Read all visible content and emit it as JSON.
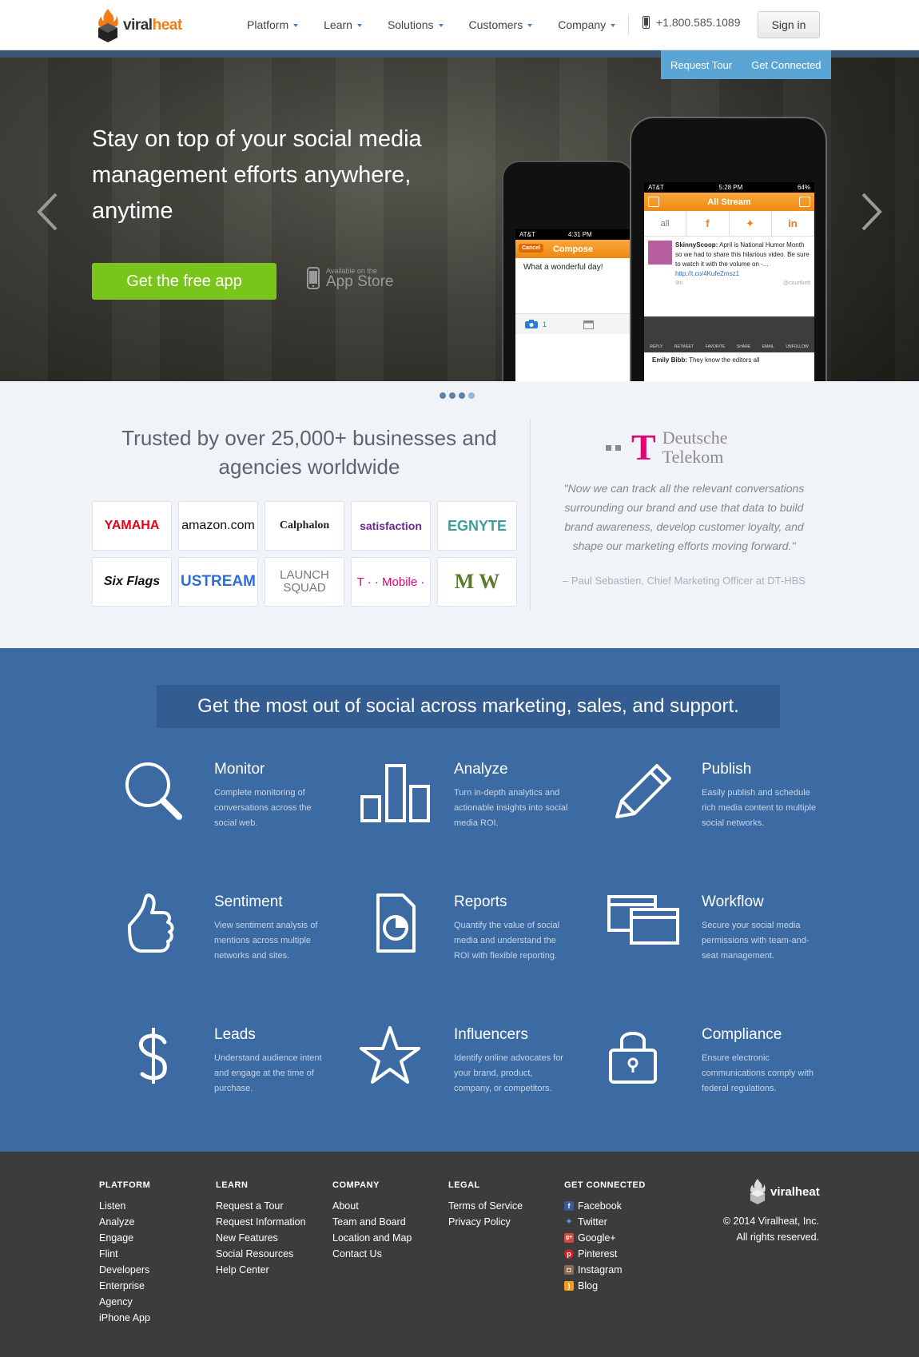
{
  "header": {
    "logo_viral": "viral",
    "logo_heat": "heat",
    "nav": [
      "Platform",
      "Learn",
      "Solutions",
      "Customers",
      "Company"
    ],
    "phone": "+1.800.585.1089",
    "signin": "Sign in"
  },
  "cta_tabs": [
    "Request Tour",
    "Get Connected"
  ],
  "hero": {
    "title": "Stay on top of your social media management efforts anywhere, anytime",
    "button": "Get the free app",
    "appstore_small": "Available on the",
    "appstore_big": "App Store",
    "slide_dots": 4,
    "active_dot": 4
  },
  "phone_back": {
    "carrier": "AT&T",
    "time": "4:31 PM",
    "cancel": "Cancel",
    "title": "Compose",
    "text": "What a wonderful day!",
    "photo_count": "1"
  },
  "phone_front": {
    "carrier": "AT&T",
    "time": "5:28 PM",
    "battery": "64%",
    "title": "All Stream",
    "tab_all": "all",
    "tweet_user": "SkinnyScoop:",
    "tweet_text": "April is National Humor Month so we had to share this hilarious video. Be sure to watch it with the volume on -...",
    "tweet_link": "http://t.co/4KufeZmsz1",
    "tweet_time": "9m",
    "tweet_handle": "@courtkett",
    "actions": [
      "REPLY",
      "RETWEET",
      "FAVORITE",
      "SHARE",
      "EMAIL",
      "UNFOLLOW"
    ],
    "next_user": "Emily Bibb:",
    "next_text": "They know the editors all"
  },
  "trusted": {
    "title": "Trusted by over 25,000+ businesses and agencies worldwide",
    "logos": [
      "YAMAHA",
      "amazon.com",
      "Calphalon",
      "satisfaction",
      "EGNYTE",
      "Six Flags",
      "USTREAM",
      "LAUNCH SQUAD",
      "T · · Mobile ·",
      "M W"
    ],
    "dt_name_1": "Deutsche",
    "dt_name_2": "Telekom",
    "quote": "\"Now we can track all the relevant conversations surrounding our brand and use that data to build brand awareness, develop customer loyalty, and shape our marketing efforts moving forward.\"",
    "quote_by": "– Paul Sebastien, Chief Marketing Officer at DT-HBS"
  },
  "features": {
    "banner": "Get the most out of social across marketing, sales, and support.",
    "items": [
      {
        "title": "Monitor",
        "desc": "Complete monitoring of conversations across the social web.",
        "icon": "magnifier-icon"
      },
      {
        "title": "Analyze",
        "desc": "Turn in-depth analytics and actionable insights into social media ROI.",
        "icon": "bar-chart-icon"
      },
      {
        "title": "Publish",
        "desc": "Easily publish and schedule rich media content to multiple social networks.",
        "icon": "pencil-icon"
      },
      {
        "title": "Sentiment",
        "desc": "View sentiment analysis of mentions across multiple networks and sites.",
        "icon": "thumbs-up-icon"
      },
      {
        "title": "Reports",
        "desc": "Quantify the value of social media and understand the ROI with flexible reporting.",
        "icon": "report-icon"
      },
      {
        "title": "Workflow",
        "desc": "Secure your social media permissions with team-and-seat management.",
        "icon": "windows-icon"
      },
      {
        "title": "Leads",
        "desc": "Understand audience intent and engage at the time of purchase.",
        "icon": "dollar-icon"
      },
      {
        "title": "Influencers",
        "desc": "Identify online advocates for your brand, product, company, or competitors.",
        "icon": "star-icon"
      },
      {
        "title": "Compliance",
        "desc": "Ensure electronic communications comply with federal regulations.",
        "icon": "lock-icon"
      }
    ]
  },
  "footer": {
    "platform": {
      "head": "PLATFORM",
      "links": [
        "Listen",
        "Analyze",
        "Engage",
        "Flint",
        "Developers",
        "Enterprise",
        "Agency",
        "iPhone App"
      ]
    },
    "learn": {
      "head": "LEARN",
      "links": [
        "Request a Tour",
        "Request Information",
        "New Features",
        "Social Resources",
        "Help Center"
      ]
    },
    "company": {
      "head": "COMPANY",
      "links": [
        "About",
        "Team and Board",
        "Location and Map",
        "Contact Us"
      ]
    },
    "legal": {
      "head": "LEGAL",
      "links": [
        "Terms of Service",
        "Privacy Policy"
      ]
    },
    "connected": {
      "head": "GET CONNECTED",
      "links": [
        "Facebook",
        "Twitter",
        "Google+",
        "Pinterest",
        "Instagram",
        "Blog"
      ]
    },
    "logo": "viralheat",
    "copyright_1": "© 2014 Viralheat, Inc.",
    "copyright_2": "All rights reserved."
  },
  "colors": {
    "accent_orange": "#f27c17",
    "brand_blue": "#3c6aa3",
    "cta_green": "#7ac51b",
    "cta_tab_blue": "#5aa5d4",
    "footer_bg": "#3c3c3c",
    "telekom_magenta": "#e20074"
  }
}
